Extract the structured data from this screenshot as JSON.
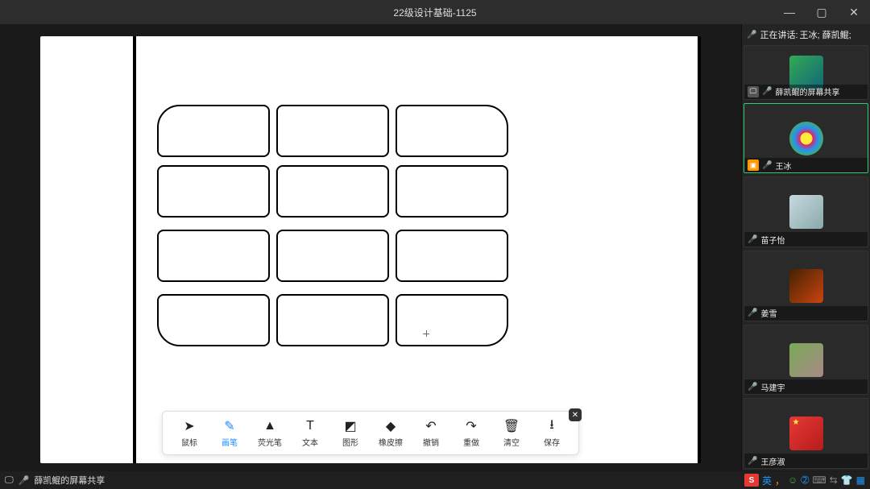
{
  "window": {
    "title": "22级设计基础-1125",
    "minimize": "—",
    "maximize": "▢",
    "close": "✕"
  },
  "speaking_bar": {
    "label": "正在讲话:",
    "names": "王冰; 薛凯鲲;"
  },
  "participants": [
    {
      "name": "薛凯鲲的屏幕共享",
      "muted": true,
      "screen": true,
      "active": false
    },
    {
      "name": "王冰",
      "muted": false,
      "active": true,
      "badge": "orange"
    },
    {
      "name": "苗子怡",
      "muted": true
    },
    {
      "name": "姜雪",
      "muted": true
    },
    {
      "name": "马建宇",
      "muted": true
    },
    {
      "name": "王彦淑",
      "muted": true
    }
  ],
  "tools": [
    {
      "id": "cursor",
      "label": "鼠标",
      "glyph": "➤"
    },
    {
      "id": "pen",
      "label": "画笔",
      "glyph": "✎",
      "active": true
    },
    {
      "id": "highlighter",
      "label": "荧光笔",
      "glyph": "▲"
    },
    {
      "id": "text",
      "label": "文本",
      "glyph": "T"
    },
    {
      "id": "shape",
      "label": "图形",
      "glyph": "◩"
    },
    {
      "id": "eraser",
      "label": "橡皮擦",
      "glyph": "◆"
    },
    {
      "id": "undo",
      "label": "撤销",
      "glyph": "↶"
    },
    {
      "id": "redo",
      "label": "重做",
      "glyph": "↷"
    },
    {
      "id": "clear",
      "label": "清空",
      "glyph": "🗑"
    },
    {
      "id": "save",
      "label": "保存",
      "glyph": "⭳"
    }
  ],
  "bottom": {
    "share_label": "薛凯鲲的屏幕共享",
    "ime": {
      "s": "S",
      "lang": "英",
      "punct": "，",
      "face": "☺",
      "at": "➁",
      "key": "⌨",
      "more1": "⇆",
      "more2": "👕",
      "more3": "▦"
    }
  }
}
